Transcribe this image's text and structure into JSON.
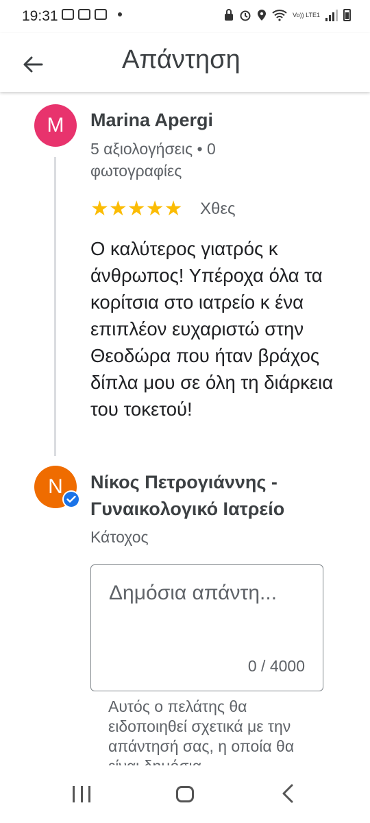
{
  "status_bar": {
    "time": "19:31",
    "network": "Vo)) LTE1"
  },
  "app_bar": {
    "title": "Απάντηση"
  },
  "review": {
    "avatar_letter": "M",
    "avatar_color": "#e8336d",
    "author": "Marina Apergi",
    "meta": "5 αξιολογήσεις • 0 φωτογραφίες",
    "rating": 5,
    "stars": "★★★★★",
    "date": "Χθες",
    "text": "Ο καλύτερος γιατρός κ άνθρωπος! Υπέροχα όλα τα κορίτσια στο ιατρείο κ ένα επιπλέον ευχαριστώ στην Θεοδώρα που ήταν βράχος δίπλα μου σε όλη τη διάρκεια του τοκετού!"
  },
  "owner": {
    "avatar_letter": "N",
    "avatar_color": "#ef6c00",
    "name": "Νίκος Πετρογιάννης - Γυναικολογικό Ιατρείο",
    "role": "Κάτοχος",
    "reply_placeholder": "Δημόσια απάντη...",
    "reply_value": "",
    "char_counter": "0 / 4000",
    "helper_text": "Αυτός ο πελάτης θα ειδοποιηθεί σχετικά με την απάντησή σας, η οποία θα είναι δημόσια"
  },
  "colors": {
    "accent": "#1a73e8",
    "star": "#fbbc04"
  }
}
